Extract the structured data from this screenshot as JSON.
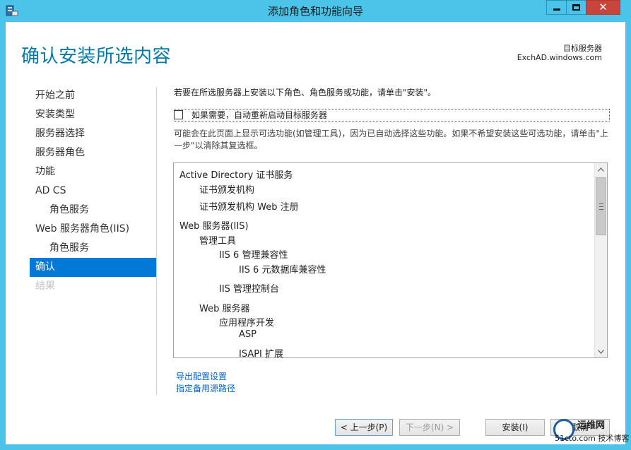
{
  "window": {
    "title": "添加角色和功能向导",
    "close_glyph": "✕"
  },
  "header": {
    "page_title": "确认安装所选内容",
    "dest_label": "目标服务器",
    "dest_server": "ExchAD.windows.com"
  },
  "nav": {
    "items": [
      {
        "label": "开始之前",
        "state": "normal"
      },
      {
        "label": "安装类型",
        "state": "normal"
      },
      {
        "label": "服务器选择",
        "state": "normal"
      },
      {
        "label": "服务器角色",
        "state": "normal"
      },
      {
        "label": "功能",
        "state": "normal"
      },
      {
        "label": "AD CS",
        "state": "normal"
      },
      {
        "label": "角色服务",
        "state": "sub"
      },
      {
        "label": "Web 服务器角色(IIS)",
        "state": "normal"
      },
      {
        "label": "角色服务",
        "state": "sub"
      },
      {
        "label": "确认",
        "state": "active"
      },
      {
        "label": "结果",
        "state": "disabled"
      }
    ]
  },
  "main": {
    "intro": "若要在所选服务器上安装以下角色、角色服务或功能，请单击\"安装\"。",
    "restart_label": "如果需要，自动重新启动目标服务器",
    "restart_checked": false,
    "note": "可能会在此页面上显示可选功能(如管理工具)，因为已自动选择这些功能。如果不希望安装这些可选功能，请单击\"上一步\"以清除其复选框。",
    "features": [
      "Active Directory 证书服务",
      "证书颁发机构",
      "证书颁发机构 Web 注册",
      "Web 服务器(IIS)",
      "管理工具",
      "IIS 6 管理兼容性",
      "IIS 6 元数据库兼容性",
      "IIS 管理控制台",
      "Web 服务器",
      "应用程序开发",
      "ASP",
      "ISAPI 扩展"
    ],
    "export_link": "导出配置设置",
    "source_link": "指定备用源路径"
  },
  "buttons": {
    "prev": "< 上一步(P)",
    "next": "下一步(N) >",
    "install": "安装(I)",
    "cancel": "取消"
  },
  "watermark": {
    "line1": "运维网",
    "line2": "51cto.com 技术博客"
  }
}
